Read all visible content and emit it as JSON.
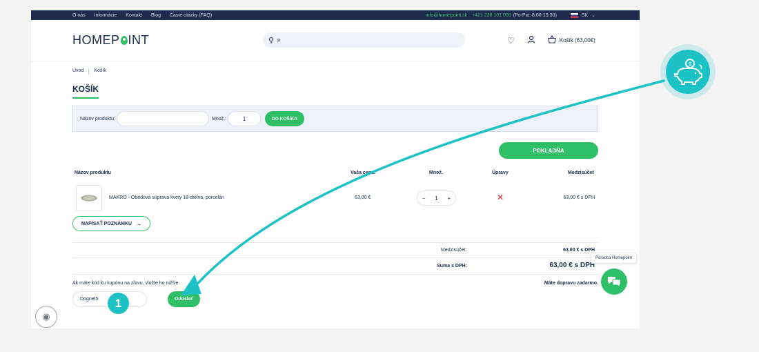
{
  "topbar": {
    "links": [
      "O nás",
      "Informácie",
      "Kontakt",
      "Blog",
      "Časté otázky (FAQ)"
    ],
    "email": "info@homepoint.sk",
    "phone": "+421 238 101 000",
    "hours": "(Po-Pia: 8:00-15:30)",
    "language": "SK"
  },
  "header": {
    "logo_left": "HOMEP",
    "logo_right": "INT",
    "search_value": "p",
    "cart_label": "Košík (63,00€)"
  },
  "breadcrumb": [
    "Úvod",
    "Košík"
  ],
  "page_title": "KOŠÍK",
  "quick_add": {
    "product_label": "Názov produktu:",
    "qty_label": "Množ.:",
    "qty_value": "1",
    "button": "DO KOŠÍKA"
  },
  "checkout_button": "POKLADŇA",
  "table": {
    "headers": {
      "product": "Názov produktu",
      "price": "Vaša cena:",
      "qty": "Množ.",
      "edit": "Úpravy",
      "subtotal": "Medzisúčet"
    },
    "rows": [
      {
        "name": "MAKRO - Obedová súprava kvety 18-dielna, porcelán",
        "price": "63,00 €",
        "qty": "1",
        "subtotal": "63,00 € s DPH"
      }
    ]
  },
  "note_button": "NAPÍSAŤ POZNÁMKU",
  "summary": {
    "subtotal_label": "Medzisúčet:",
    "subtotal_value": "63,00 € s DPH",
    "total_label": "Suma s DPH:",
    "total_value": "63,00 € s DPH"
  },
  "coupon": {
    "text": "Ak máte kód ku kupónu na zľavu, vložte ho nižšie",
    "value": "Dognet5",
    "button": "Odoslať"
  },
  "delivery_text": "Máte dopravu zadarmo.",
  "helper_tooltip": "Poradca Homepoint",
  "step_number": "1",
  "colors": {
    "brand_green": "#2fbf67",
    "navy": "#1e2b4f",
    "teal_overlay": "#1cc2c6",
    "remove_red": "#d62b3a"
  }
}
